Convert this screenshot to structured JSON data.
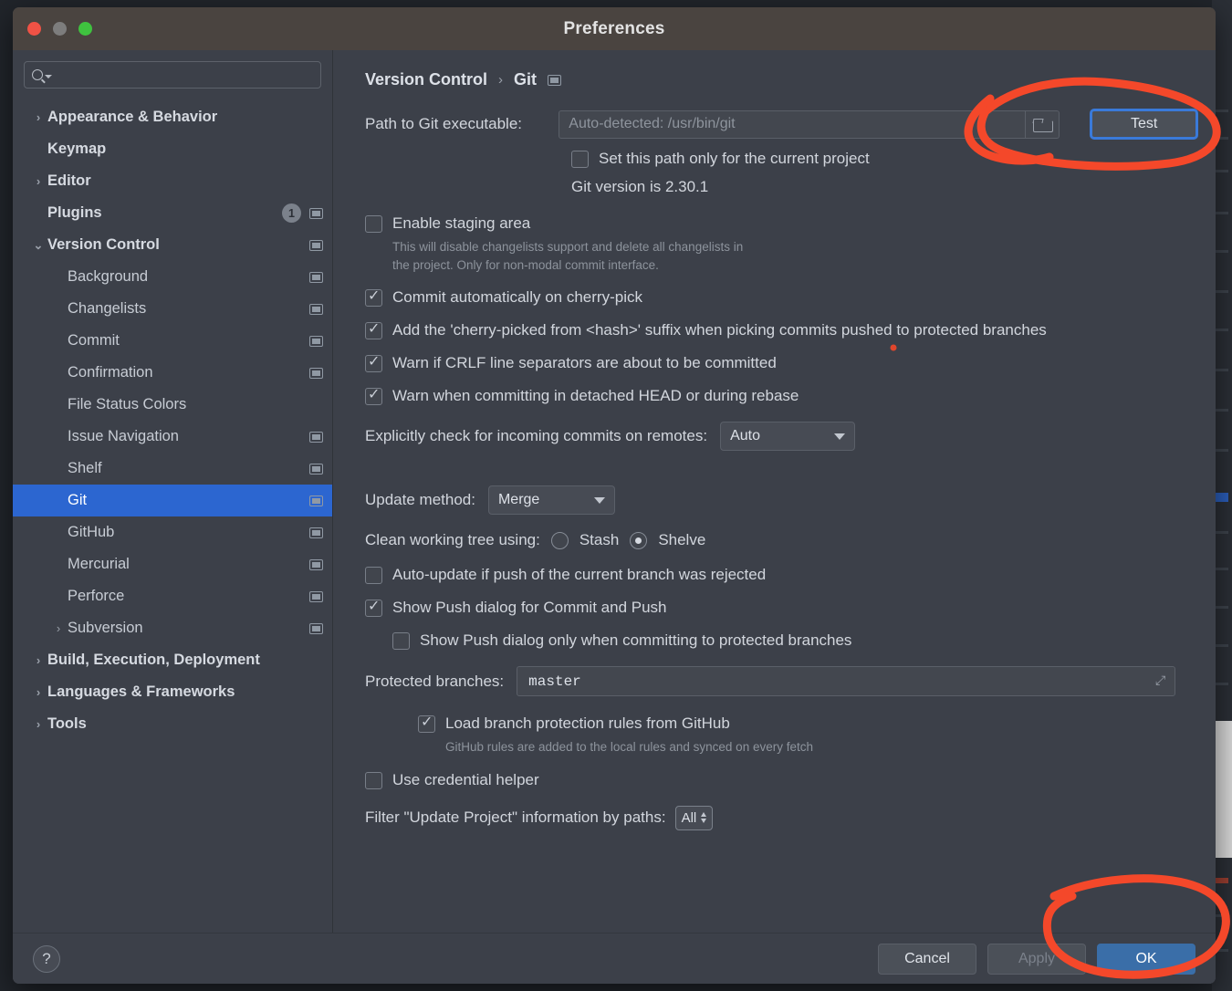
{
  "window": {
    "title": "Preferences",
    "traffic_lights": [
      "close-button",
      "minimize-button",
      "zoom-button"
    ]
  },
  "sidebar": {
    "search": {
      "placeholder": "",
      "icon": "search-icon"
    },
    "items": [
      {
        "label": "Appearance & Behavior",
        "level": 0,
        "bold": true,
        "chevron": "›",
        "badge": null,
        "scope_icon": false,
        "selected": false
      },
      {
        "label": "Keymap",
        "level": 0,
        "bold": true,
        "chevron": "",
        "badge": null,
        "scope_icon": false,
        "selected": false
      },
      {
        "label": "Editor",
        "level": 0,
        "bold": true,
        "chevron": "›",
        "badge": null,
        "scope_icon": false,
        "selected": false
      },
      {
        "label": "Plugins",
        "level": 0,
        "bold": true,
        "chevron": "",
        "badge": "1",
        "scope_icon": true,
        "selected": false
      },
      {
        "label": "Version Control",
        "level": 0,
        "bold": true,
        "chevron": "⌄",
        "badge": null,
        "scope_icon": true,
        "selected": false
      },
      {
        "label": "Background",
        "level": 1,
        "bold": false,
        "chevron": "",
        "badge": null,
        "scope_icon": true,
        "selected": false
      },
      {
        "label": "Changelists",
        "level": 1,
        "bold": false,
        "chevron": "",
        "badge": null,
        "scope_icon": true,
        "selected": false
      },
      {
        "label": "Commit",
        "level": 1,
        "bold": false,
        "chevron": "",
        "badge": null,
        "scope_icon": true,
        "selected": false
      },
      {
        "label": "Confirmation",
        "level": 1,
        "bold": false,
        "chevron": "",
        "badge": null,
        "scope_icon": true,
        "selected": false
      },
      {
        "label": "File Status Colors",
        "level": 1,
        "bold": false,
        "chevron": "",
        "badge": null,
        "scope_icon": false,
        "selected": false
      },
      {
        "label": "Issue Navigation",
        "level": 1,
        "bold": false,
        "chevron": "",
        "badge": null,
        "scope_icon": true,
        "selected": false
      },
      {
        "label": "Shelf",
        "level": 1,
        "bold": false,
        "chevron": "",
        "badge": null,
        "scope_icon": true,
        "selected": false
      },
      {
        "label": "Git",
        "level": 1,
        "bold": false,
        "chevron": "",
        "badge": null,
        "scope_icon": true,
        "selected": true
      },
      {
        "label": "GitHub",
        "level": 1,
        "bold": false,
        "chevron": "",
        "badge": null,
        "scope_icon": true,
        "selected": false
      },
      {
        "label": "Mercurial",
        "level": 1,
        "bold": false,
        "chevron": "",
        "badge": null,
        "scope_icon": true,
        "selected": false
      },
      {
        "label": "Perforce",
        "level": 1,
        "bold": false,
        "chevron": "",
        "badge": null,
        "scope_icon": true,
        "selected": false
      },
      {
        "label": "Subversion",
        "level": 1,
        "bold": false,
        "chevron": "›",
        "badge": null,
        "scope_icon": true,
        "selected": false
      },
      {
        "label": "Build, Execution, Deployment",
        "level": 0,
        "bold": true,
        "chevron": "›",
        "badge": null,
        "scope_icon": false,
        "selected": false
      },
      {
        "label": "Languages & Frameworks",
        "level": 0,
        "bold": true,
        "chevron": "›",
        "badge": null,
        "scope_icon": false,
        "selected": false
      },
      {
        "label": "Tools",
        "level": 0,
        "bold": true,
        "chevron": "›",
        "badge": null,
        "scope_icon": false,
        "selected": false
      }
    ]
  },
  "main": {
    "breadcrumb": {
      "parent": "Version Control",
      "separator": "›",
      "current": "Git"
    },
    "path_label": "Path to Git executable:",
    "path_placeholder": "Auto-detected: /usr/bin/git",
    "test_button": "Test",
    "set_path_only": "Set this path only for the current project",
    "git_version": "Git version is 2.30.1",
    "enable_staging": "Enable staging area",
    "staging_hint_line1": "This will disable changelists support and delete all changelists in",
    "staging_hint_line2": "the project. Only for non-modal commit interface.",
    "commit_auto_cherry_pick": "Commit automatically on cherry-pick",
    "add_cherry_picked_suffix": "Add the 'cherry-picked from <hash>' suffix when picking commits pushed to protected branches",
    "warn_crlf": "Warn if CRLF line separators are about to be committed",
    "warn_detached_head": "Warn when committing in detached HEAD or during rebase",
    "explicit_check_label": "Explicitly check for incoming commits on remotes:",
    "explicit_check_value": "Auto",
    "update_method_label": "Update method:",
    "update_method_value": "Merge",
    "clean_tree_label": "Clean working tree using:",
    "clean_tree_stash": "Stash",
    "clean_tree_shelve": "Shelve",
    "auto_update_rejected": "Auto-update if push of the current branch was rejected",
    "show_push_dialog": "Show Push dialog for Commit and Push",
    "show_push_protected": "Show Push dialog only when committing to protected branches",
    "protected_branches_label": "Protected branches:",
    "protected_branches_value": "master",
    "load_branch_rules": "Load branch protection rules from GitHub",
    "load_branch_rules_hint": "GitHub rules are added to the local rules and synced on every fetch",
    "use_credential_helper": "Use credential helper",
    "filter_update_label": "Filter \"Update Project\" information by paths:",
    "filter_update_value": "All"
  },
  "footer": {
    "help": "?",
    "cancel": "Cancel",
    "apply": "Apply",
    "ok": "OK"
  },
  "colors": {
    "selection_blue": "#2c66d0",
    "primary_button": "#3a6ea8",
    "focus_ring": "#3a7ad9",
    "annotation_red": "#f4482a",
    "window_bg": "#3c4049",
    "titlebar_bg": "#4a4440"
  }
}
